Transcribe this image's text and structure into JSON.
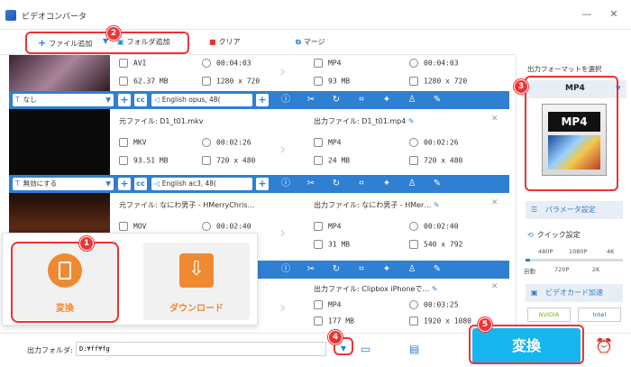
{
  "window": {
    "title": "ビデオコンバータ"
  },
  "toolbar": {
    "add_file": "ファイル追加",
    "add_folder": "フォルダ追加",
    "clear": "クリア",
    "merge": "マージ"
  },
  "files": [
    {
      "source_format": "AVI",
      "source_duration": "00:04:03",
      "source_size": "62.37 MB",
      "source_resolution": "1280 x 720",
      "output_format": "MP4",
      "output_duration": "00:04:03",
      "output_size": "93 MB",
      "output_resolution": "1280 x 720",
      "subtitle": "なし",
      "audio": "English opus, 48("
    },
    {
      "source_name": "元ファイル: D1_t01.mkv",
      "output_name": "出力ファイル: D1_t01.mp4",
      "source_format": "MKV",
      "source_duration": "00:02:26",
      "source_size": "93.51 MB",
      "source_resolution": "720 x 480",
      "output_format": "MP4",
      "output_duration": "00:02:26",
      "output_size": "24 MB",
      "output_resolution": "720 x 480",
      "subtitle": "無効にする",
      "audio": "English ac3, 48("
    },
    {
      "source_name": "元ファイル: なにわ男子 - HMerryChris…",
      "output_name": "出力ファイル: なにわ男子 - HMer…",
      "source_format": "MOV",
      "source_duration": "00:02:40",
      "output_format": "MP4",
      "output_duration": "00:02:40",
      "output_size": "31 MB",
      "output_resolution": "540 x 792"
    },
    {
      "output_name": "出力ファイル: Clipbox iPhoneで…",
      "output_format": "MP4",
      "output_duration": "00:03:25",
      "output_size": "177 MB",
      "output_resolution": "1920 x 1080"
    }
  ],
  "popup": {
    "convert": "変換",
    "download": "ダウンロード"
  },
  "right_panel": {
    "select_format_label": "出力フォーマットを選択",
    "selected_format": "MP4",
    "format_icon_text": "MP4",
    "params": "パラメータ設定",
    "quick_setting": "クイック設定",
    "quality_top": [
      "480P",
      "1080P",
      "4K"
    ],
    "quality_bottom": [
      "自動",
      "720P",
      "2K"
    ],
    "quality_level": 0.05,
    "gpu": "ビデオカード加速",
    "nvidia": "NVIDIA",
    "intel": "Intel"
  },
  "bottom": {
    "output_folder_label": "出力フォルダ:",
    "output_folder_value": "D:¥ff¥fg",
    "convert_button": "変換"
  },
  "badges": [
    "1",
    "2",
    "3",
    "4",
    "5"
  ],
  "colors": {
    "accent": "#2f7fd3",
    "highlight": "#e33333",
    "orange": "#ef8a32",
    "convert_button": "#17b6f0"
  }
}
